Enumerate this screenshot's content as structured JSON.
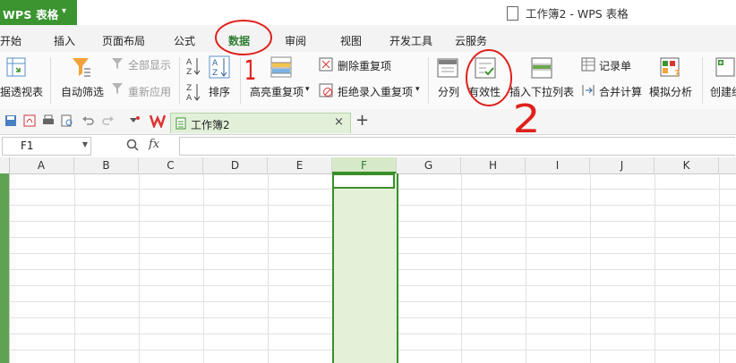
{
  "app": {
    "name": "WPS 表格",
    "menu_caret": "▾",
    "window_title": "工作簿2 - WPS 表格"
  },
  "menu": [
    "开始",
    "插入",
    "页面布局",
    "公式",
    "数据",
    "审阅",
    "视图",
    "开发工具",
    "云服务"
  ],
  "active_menu": "数据",
  "ribbon": {
    "pivot": "据透视表",
    "autofilter": "自动筛选",
    "show_all": "全部显示",
    "reapply": "重新应用",
    "sort": "排序",
    "highlight_dup": "高亮重复项",
    "remove_dup": "删除重复项",
    "reject_dup": "拒绝录入重复项",
    "split": "分列",
    "validity": "有效性",
    "insert_dropdown": "插入下拉列表",
    "record": "记录单",
    "consolidate": "合并计算",
    "simulate": "模拟分析",
    "create_group": "创建组"
  },
  "document_tab": {
    "label": "工作簿2",
    "close": "×",
    "add": "+"
  },
  "formula_bar": {
    "name_box": "F1",
    "fx": "fx"
  },
  "columns": [
    "A",
    "B",
    "C",
    "D",
    "E",
    "F",
    "G",
    "H",
    "I",
    "J",
    "K"
  ],
  "selected_column": "F",
  "annotations": {
    "circle_1_label": "1",
    "circle_2_label": "2"
  },
  "colors": {
    "accent_green": "#3b9430",
    "annotation_red": "#e0201c",
    "selection_fill": "#e3f1d8"
  }
}
